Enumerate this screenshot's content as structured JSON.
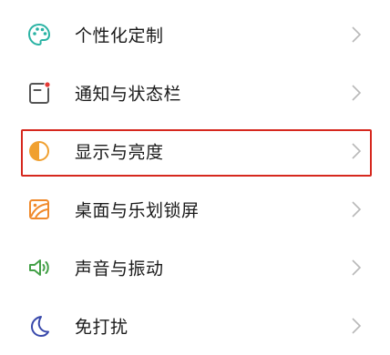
{
  "settings_items": [
    {
      "label": "个性化定制",
      "icon": "palette-icon",
      "icon_color": "#2ab3a4"
    },
    {
      "label": "通知与状态栏",
      "icon": "notification-panel-icon",
      "icon_color": "#555555",
      "badge_color": "#e53935"
    },
    {
      "label": "显示与亮度",
      "icon": "brightness-icon",
      "icon_color": "#f0a030"
    },
    {
      "label": "桌面与乐划锁屏",
      "icon": "wallpaper-icon",
      "icon_color": "#f08a2c"
    },
    {
      "label": "声音与振动",
      "icon": "speaker-icon",
      "icon_color": "#43a047"
    },
    {
      "label": "免打扰",
      "icon": "moon-icon",
      "icon_color": "#3949ab"
    }
  ],
  "highlight_color": "#d6281e",
  "chevron_icon": "chevron-right-icon"
}
